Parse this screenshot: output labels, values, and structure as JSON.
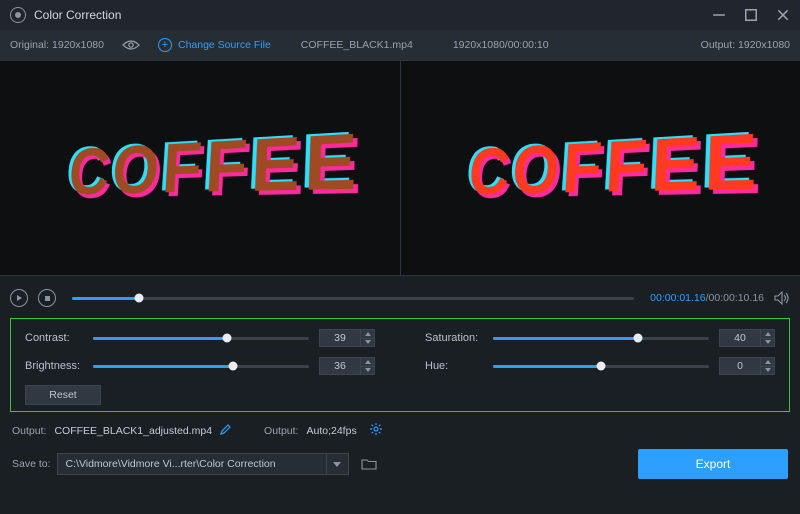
{
  "titlebar": {
    "title": "Color Correction"
  },
  "infobar": {
    "original_label": "Original:  1920x1080",
    "change_label": "Change Source File",
    "filename": "COFFEE_BLACK1.mp4",
    "dimensions_time": "1920x1080/00:00:10",
    "output_label": "Output: 1920x1080"
  },
  "preview": {
    "word": "COFFEE"
  },
  "playbar": {
    "current": "00:00:01.16",
    "total": "/00:00:10.16",
    "progress_pct": 12
  },
  "controls": {
    "contrast": {
      "label": "Contrast:",
      "value": "39",
      "pct": 62
    },
    "brightness": {
      "label": "Brightness:",
      "value": "36",
      "pct": 65
    },
    "saturation": {
      "label": "Saturation:",
      "value": "40",
      "pct": 67
    },
    "hue": {
      "label": "Hue:",
      "value": "0",
      "pct": 50
    },
    "reset_label": "Reset"
  },
  "output": {
    "label1": "Output:",
    "filename": "COFFEE_BLACK1_adjusted.mp4",
    "label2": "Output:",
    "settings": "Auto;24fps"
  },
  "save": {
    "label": "Save to:",
    "path": "C:\\Vidmore\\Vidmore Vi...rter\\Color Correction"
  },
  "export_label": "Export"
}
